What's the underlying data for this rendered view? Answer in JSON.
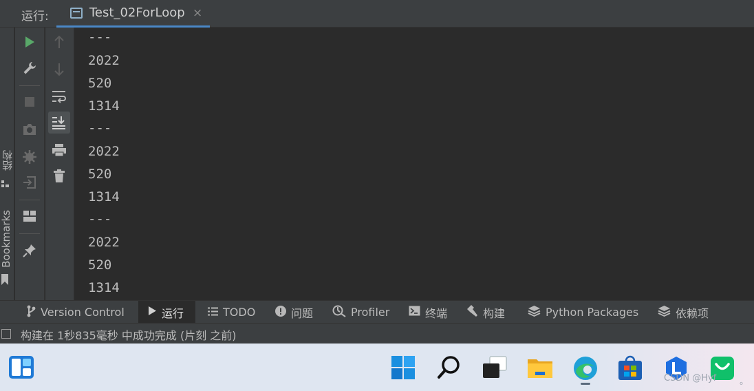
{
  "run_panel": {
    "label": "运行:",
    "tab": {
      "title": "Test_02ForLoop",
      "close": "×"
    }
  },
  "side_strip": {
    "structure": "结构",
    "bookmarks": "Bookmarks"
  },
  "toolbar_left": [
    "run-icon",
    "wrench-icon",
    "stop-icon",
    "camera-icon",
    "settings-bug-icon",
    "exit-icon",
    "layout-icon",
    "pin-icon"
  ],
  "toolbar_right": [
    "up-arrow-icon",
    "down-arrow-icon",
    "soft-wrap-icon",
    "scroll-to-end-icon",
    "print-icon",
    "trash-icon"
  ],
  "console_lines": [
    "---",
    "2022",
    "520",
    "1314",
    "---",
    "2022",
    "520",
    "1314",
    "---",
    "2022",
    "520",
    "1314"
  ],
  "bottom_tabs": [
    {
      "label": "Version Control",
      "icon": "branch-icon"
    },
    {
      "label": "运行",
      "icon": "run-icon",
      "active": true
    },
    {
      "label": "TODO",
      "icon": "list-icon"
    },
    {
      "label": "问题",
      "icon": "info-icon"
    },
    {
      "label": "Profiler",
      "icon": "profiler-icon"
    },
    {
      "label": "终端",
      "icon": "terminal-icon"
    },
    {
      "label": "构建",
      "icon": "hammer-icon"
    },
    {
      "label": "Python Packages",
      "icon": "layers-icon"
    },
    {
      "label": "依赖项",
      "icon": "layers-icon"
    }
  ],
  "status": {
    "text": "构建在 1秒835毫秒 中成功完成 (片刻 之前)"
  },
  "taskbar": {
    "apps": [
      "windows-start-icon",
      "search-icon",
      "task-view-icon",
      "file-explorer-icon",
      "edge-browser-icon",
      "store-icon",
      "app-blue-icon",
      "app-green-icon"
    ],
    "watermark": "CSDN @Hyf",
    "dot": "。"
  },
  "colors": {
    "accent": "#4a88c7",
    "run_green": "#59a869",
    "background": "#2b2b2b",
    "panel": "#3c3f41"
  }
}
